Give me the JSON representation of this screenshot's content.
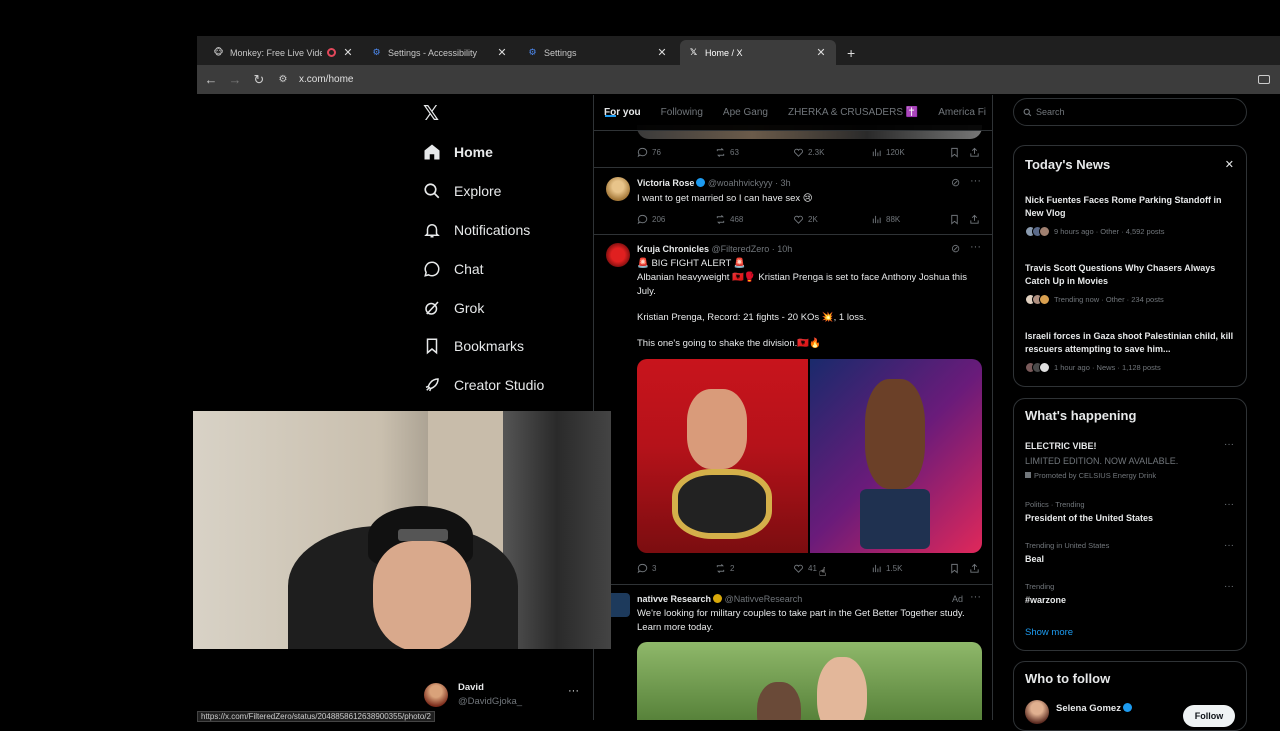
{
  "browser": {
    "tabs": [
      {
        "title": "Monkey: Free Live Video Ch",
        "close": "✕"
      },
      {
        "title": "Settings - Accessibility",
        "close": "✕"
      },
      {
        "title": "Settings",
        "close": "✕"
      },
      {
        "title": "Home / X",
        "close": "✕"
      }
    ],
    "new_tab": "+",
    "url": "x.com/home",
    "status_url": "https://x.com/FilteredZero/status/2048858612638900355/photo/2"
  },
  "sidebar": {
    "logo": "𝕏",
    "items": [
      {
        "label": "Home",
        "icon": "home-icon"
      },
      {
        "label": "Explore",
        "icon": "search-icon"
      },
      {
        "label": "Notifications",
        "icon": "bell-icon"
      },
      {
        "label": "Chat",
        "icon": "chat-icon"
      },
      {
        "label": "Grok",
        "icon": "grok-icon"
      },
      {
        "label": "Bookmarks",
        "icon": "bookmark-icon"
      },
      {
        "label": "Creator Studio",
        "icon": "rocket-icon"
      }
    ],
    "account": {
      "name": "David",
      "handle": "@DavidGjoka_",
      "more": "···"
    }
  },
  "feed": {
    "tabs": [
      "For you",
      "Following",
      "Ape Gang",
      "ZHERKA & CRUSADERS ✝️",
      "America Fi"
    ],
    "posts": [
      {
        "replies": "76",
        "reposts": "63",
        "likes": "2.3K",
        "views": "120K"
      },
      {
        "name": "Victoria Rose",
        "handle": "@woahhvickyyy",
        "time": "· 3h",
        "text": "I want to get married so I can have sex 😢",
        "replies": "206",
        "reposts": "468",
        "likes": "2K",
        "views": "88K"
      },
      {
        "name": "Kruja Chronicles",
        "handle": "@FilteredZero",
        "time": "· 10h",
        "lines": [
          "🚨 BIG FIGHT ALERT 🚨",
          "Albanian heavyweight 🇦🇱🥊 Kristian Prenga is set to face Anthony Joshua this July.",
          "Kristian Prenga, Record: 21 fights - 20 KOs 💥, 1 loss.",
          "This one's going to shake the division.🇦🇱🔥"
        ],
        "replies": "3",
        "reposts": "2",
        "likes": "41",
        "views": "1.5K"
      },
      {
        "name": "nativve Research",
        "handle": "@NativveResearch",
        "ad": "Ad",
        "text": "We're looking for military couples to take part in the Get Better Together study. Learn more today."
      }
    ]
  },
  "search": {
    "placeholder": "Search"
  },
  "todays_news": {
    "title": "Today's News",
    "close": "✕",
    "items": [
      {
        "title": "Nick Fuentes Faces Rome Parking Standoff in New Vlog",
        "meta": "9 hours ago · Other · 4,592 posts"
      },
      {
        "title": "Travis Scott Questions Why Chasers Always Catch Up in Movies",
        "meta": "Trending now · Other · 234 posts"
      },
      {
        "title": "Israeli forces in Gaza shoot Palestinian child, kill rescuers attempting to save him...",
        "meta": "1 hour ago · News · 1,128 posts"
      }
    ]
  },
  "whats_happening": {
    "title": "What's happening",
    "promo": {
      "title": "ELECTRIC VIBE!",
      "subtitle": "LIMITED EDITION. NOW AVAILABLE.",
      "meta": "Promoted by CELSIUS Energy Drink"
    },
    "trends": [
      {
        "meta": "Politics · Trending",
        "title": "President of the United States"
      },
      {
        "meta": "Trending in United States",
        "title": "Beal"
      },
      {
        "meta": "Trending",
        "title": "#warzone"
      }
    ],
    "show_more": "Show more"
  },
  "who_to_follow": {
    "title": "Who to follow",
    "user": {
      "name": "Selena Gomez",
      "button": "Follow"
    }
  },
  "colors": {
    "accent": "#1d9bf0",
    "border": "#2f3336",
    "muted": "#71767b",
    "text": "#e7e9ea"
  }
}
